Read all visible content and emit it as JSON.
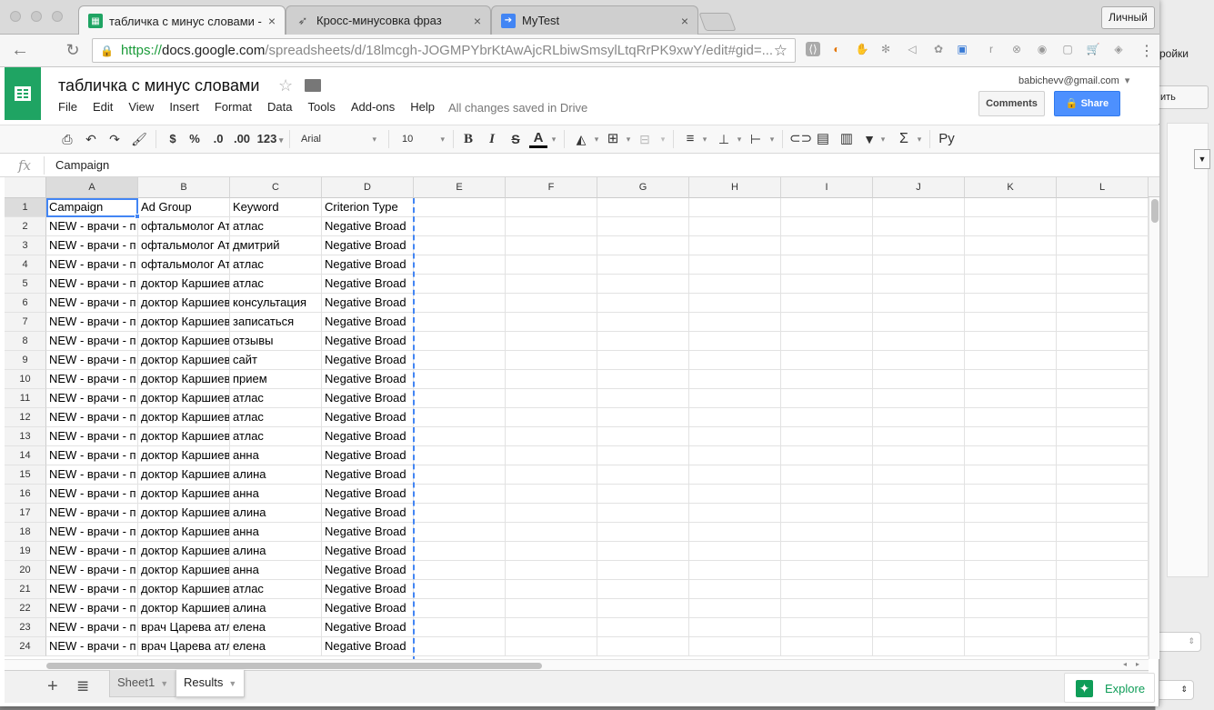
{
  "browser": {
    "tabs": [
      {
        "label": "табличка с минус словами -",
        "icon": "sheets-icon",
        "active": true
      },
      {
        "label": "Кросс-минусовка фраз",
        "icon": "rocket-icon",
        "active": false
      },
      {
        "label": "MyTest",
        "icon": "arrow-icon",
        "active": false
      }
    ],
    "profile_label": "Личный",
    "url_https": "https://",
    "url_host": "docs.google.com",
    "url_path": "/spreadsheets/d/18lmcgh-JOGMPYbrKtAwAjcRLbiwSmsylLtqRrPK9xwY/edit#gid=..."
  },
  "background_window": {
    "title": "ройки",
    "button": "ить"
  },
  "doc": {
    "title": "табличка с минус словами",
    "menu": [
      "File",
      "Edit",
      "View",
      "Insert",
      "Format",
      "Data",
      "Tools",
      "Add-ons",
      "Help"
    ],
    "save_status": "All changes saved in Drive",
    "account": "babichevv@gmail.com",
    "comments_label": "Comments",
    "share_label": "Share"
  },
  "format_toolbar": {
    "currency": "$",
    "percent": "%",
    "decimal_less": ".0",
    "decimal_more": ".00",
    "number_format": "123",
    "font": "Arial",
    "font_size": "10",
    "bold": "B",
    "italic": "I",
    "strike": "S",
    "text_color": "A",
    "input_tools": "Ру"
  },
  "formula_bar": {
    "fx": "fx",
    "value": "Campaign"
  },
  "grid": {
    "columns": [
      "A",
      "B",
      "C",
      "D",
      "E",
      "F",
      "G",
      "H",
      "I",
      "J",
      "K",
      "L"
    ],
    "rows": [
      [
        "Campaign",
        "Ad Group",
        "Keyword",
        "Criterion Type"
      ],
      [
        "NEW - врачи - п",
        "офтальмолог Ат",
        "атлас",
        "Negative Broad"
      ],
      [
        "NEW - врачи - п",
        "офтальмолог Ат",
        "дмитрий",
        "Negative Broad"
      ],
      [
        "NEW - врачи - п",
        "офтальмолог Ат",
        "атлас",
        "Negative Broad"
      ],
      [
        "NEW - врачи - п",
        "доктор Каршиев",
        "атлас",
        "Negative Broad"
      ],
      [
        "NEW - врачи - п",
        "доктор Каршиев",
        "консультация",
        "Negative Broad"
      ],
      [
        "NEW - врачи - п",
        "доктор Каршиев",
        "записаться",
        "Negative Broad"
      ],
      [
        "NEW - врачи - п",
        "доктор Каршиев",
        "отзывы",
        "Negative Broad"
      ],
      [
        "NEW - врачи - п",
        "доктор Каршиев",
        "сайт",
        "Negative Broad"
      ],
      [
        "NEW - врачи - п",
        "доктор Каршиев",
        "прием",
        "Negative Broad"
      ],
      [
        "NEW - врачи - п",
        "доктор Каршиев",
        "атлас",
        "Negative Broad"
      ],
      [
        "NEW - врачи - п",
        "доктор Каршиев",
        "атлас",
        "Negative Broad"
      ],
      [
        "NEW - врачи - п",
        "доктор Каршиев",
        "атлас",
        "Negative Broad"
      ],
      [
        "NEW - врачи - п",
        "доктор Каршиев",
        "анна",
        "Negative Broad"
      ],
      [
        "NEW - врачи - п",
        "доктор Каршиев",
        "алина",
        "Negative Broad"
      ],
      [
        "NEW - врачи - п",
        "доктор Каршиев",
        "анна",
        "Negative Broad"
      ],
      [
        "NEW - врачи - п",
        "доктор Каршиев",
        "алина",
        "Negative Broad"
      ],
      [
        "NEW - врачи - п",
        "доктор Каршиев",
        "анна",
        "Negative Broad"
      ],
      [
        "NEW - врачи - п",
        "доктор Каршиев",
        "алина",
        "Negative Broad"
      ],
      [
        "NEW - врачи - п",
        "доктор Каршиев",
        "анна",
        "Negative Broad"
      ],
      [
        "NEW - врачи - п",
        "доктор Каршиев",
        "атлас",
        "Negative Broad"
      ],
      [
        "NEW - врачи - п",
        "доктор Каршиев",
        "алина",
        "Negative Broad"
      ],
      [
        "NEW - врачи - п",
        "врач Царева атл",
        "елена",
        "Negative Broad"
      ],
      [
        "NEW - врачи - п",
        "врач Царева атл",
        "елена",
        "Negative Broad"
      ]
    ]
  },
  "sheets": {
    "tabs": [
      {
        "label": "Sheet1",
        "active": false
      },
      {
        "label": "Results",
        "active": true
      }
    ],
    "explore_label": "Explore"
  },
  "colors": {
    "sheets_green": "#1fa463",
    "share_blue": "#4d90fe",
    "selection_blue": "#4285f4",
    "explore_green": "#0f9d58"
  }
}
